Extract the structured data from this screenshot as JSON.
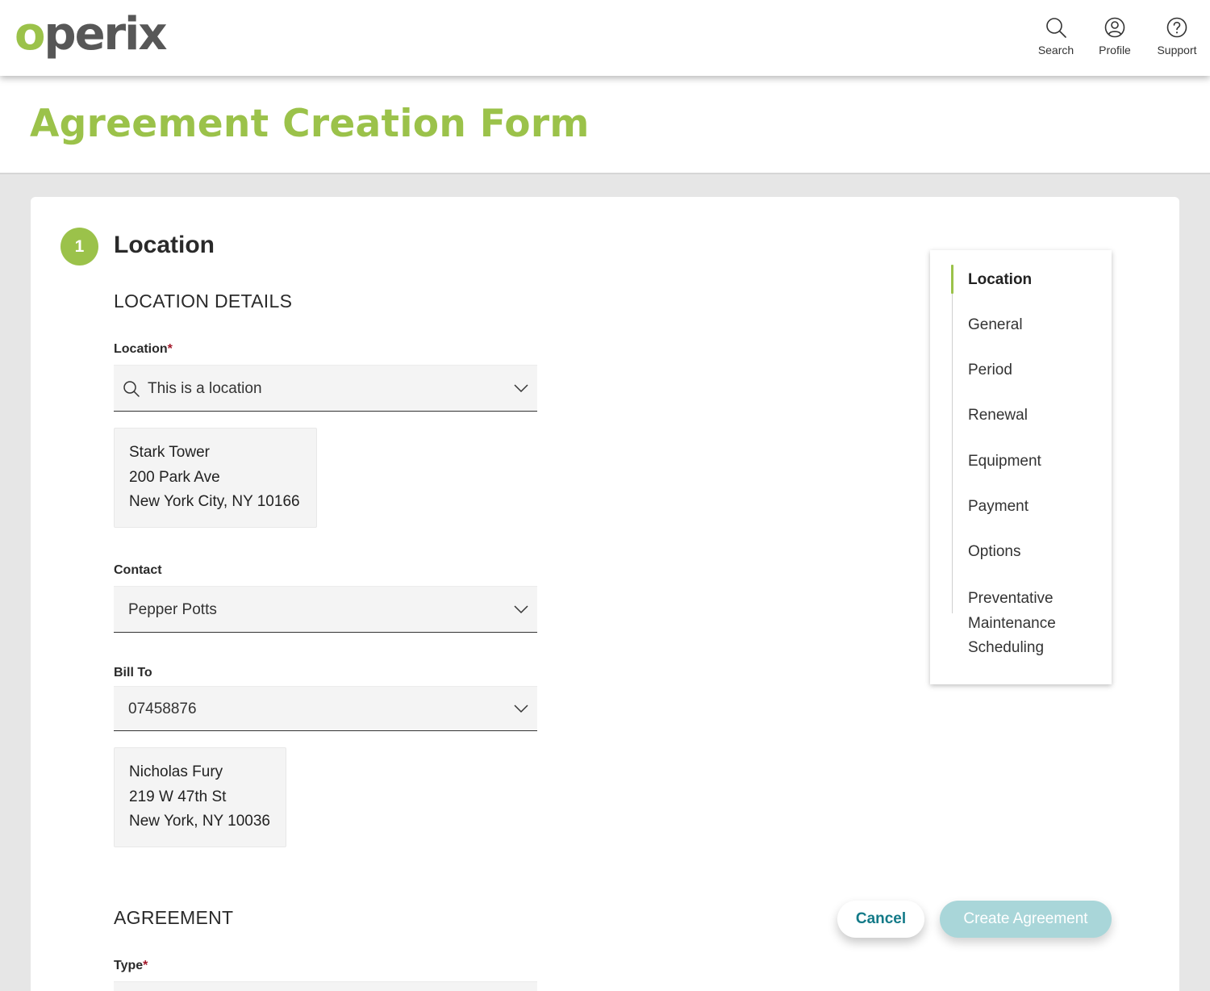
{
  "header": {
    "logo_o": "o",
    "logo_rest": "perix",
    "nav": [
      {
        "label": "Search",
        "icon": "search-icon"
      },
      {
        "label": "Profile",
        "icon": "profile-icon"
      },
      {
        "label": "Support",
        "icon": "help-icon"
      }
    ]
  },
  "page": {
    "title": "Agreement Creation Form"
  },
  "step": {
    "number": "1",
    "title": "Location"
  },
  "location_details": {
    "heading": "LOCATION DETAILS",
    "location_label": "Location",
    "required_mark": "*",
    "location_value": "This is a location",
    "location_address": [
      "Stark Tower",
      "200 Park Ave",
      "New York City, NY 10166"
    ],
    "contact_label": "Contact",
    "contact_value": "Pepper Potts",
    "billto_label": "Bill To",
    "billto_value": "07458876",
    "billto_address": [
      "Nicholas Fury",
      "219 W 47th St",
      "New York, NY 10036"
    ]
  },
  "agreement": {
    "heading": "AGREEMENT",
    "type_label": "Type",
    "required_mark": "*"
  },
  "stepnav": {
    "items": [
      "Location",
      "General",
      "Period",
      "Renewal",
      "Equipment",
      "Payment",
      "Options"
    ],
    "last_item_lines": [
      "Preventative",
      "Maintenance",
      "Scheduling"
    ],
    "active": "Location"
  },
  "actions": {
    "cancel_label": "Cancel",
    "create_label": "Create Agreement"
  },
  "colors": {
    "brand_green": "#9bc24a",
    "logo_gray": "#575757",
    "cancel_teal": "#137a88",
    "create_disabled": "#a9d6d9",
    "required_red": "#a3192b"
  }
}
